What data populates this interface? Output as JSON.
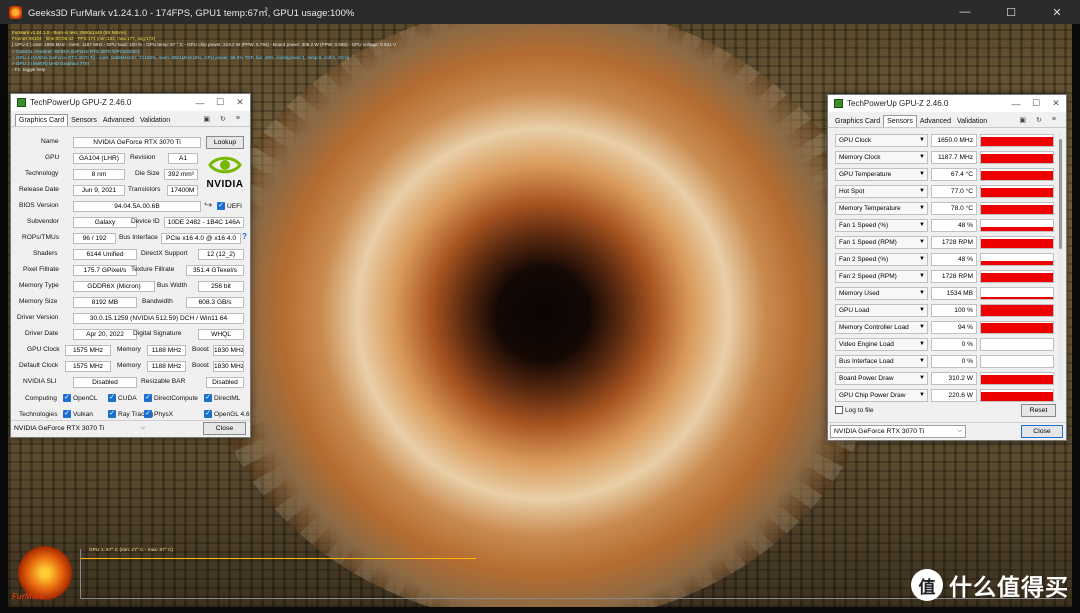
{
  "furmark": {
    "title": "Geeks3D FurMark v1.24.1.0 - 174FPS, GPU1 temp:67㎡, GPU1 usage:100%",
    "overlay": [
      {
        "text": "FurMark v1.24.1.0 - Burn-in test, 2560x1440 (8X MSAA)",
        "color": "yel"
      },
      {
        "text": "Frames:65104 - time:00:06:42 - FPS:174 (min:133, max:177, avg:172)",
        "color": "yel"
      },
      {
        "text": "[ GPU-Z ] core: 1665 MHz - mem: 1187 MHz - GPU load: 100 % - GPU temp: 67 ° C - GPU chip power: 219.2 W (PPW: 0.794) - Board power: 308.2 W (PPW: 0.565) - GPU voltage: 0.831 V",
        "color": ""
      },
      {
        "text": "> OpenGL renderer: NVIDIA GeForce RTX 3070 Ti/PCIe/SSE2",
        "color": "cyan"
      },
      {
        "text": "> GPU 1 (NVIDIA GeForce RTX 3070 Ti) - core: 1665MHz/67 °C/100%, mem: 9501MHz/18%, GPU power: 99.0% TDP, fan: 48%, limits(power:1, temp:0, volt:0, OV:0)",
        "color": "cyan"
      },
      {
        "text": "> GPU 2 (Intel(R) UHD Graphics 770)",
        "color": "cyan"
      },
      {
        "text": "- F1: toggle help",
        "color": ""
      }
    ],
    "graph_label": "GPU 1: 67° C (min: 27° C - max: 67° C)",
    "logo_text": "FurMark",
    "watermark_text": "什么值得买",
    "watermark_icon": "值",
    "window_buttons": {
      "minimize": "—",
      "maximize": "☐",
      "close": "✕"
    }
  },
  "gpuz_card": {
    "title": "TechPowerUp GPU-Z 2.46.0",
    "tabs": [
      "Graphics Card",
      "Sensors",
      "Advanced",
      "Validation"
    ],
    "active_tab": 0,
    "lookup_label": "Lookup",
    "vendor_logo_text": "NVIDIA",
    "uefi_label": "UEFI",
    "fields": {
      "name_label": "Name",
      "name": "NVIDIA GeForce RTX 3070 Ti",
      "gpu_label": "GPU",
      "gpu": "GA104 (LHR)",
      "revision_label": "Revision",
      "revision": "A1",
      "technology_label": "Technology",
      "technology": "8 nm",
      "die_size_label": "Die Size",
      "die_size": "392 mm²",
      "release_label": "Release Date",
      "release": "Jun 9, 2021",
      "transistors_label": "Transistors",
      "transistors": "17400M",
      "bios_label": "BIOS Version",
      "bios": "94.04.5A.00.6B",
      "subvendor_label": "Subvendor",
      "subvendor": "Galaxy",
      "device_id_label": "Device ID",
      "device_id": "10DE 2482 - 1B4C 146A",
      "rops_label": "ROPs/TMUs",
      "rops": "96 / 192",
      "bus_interface_label": "Bus Interface",
      "bus_interface": "PCIe x16 4.0 @ x16 4.0",
      "shaders_label": "Shaders",
      "shaders": "6144 Unified",
      "directx_label": "DirectX Support",
      "directx": "12 (12_2)",
      "pixel_fill_label": "Pixel Fillrate",
      "pixel_fill": "175.7 GPixel/s",
      "texture_fill_label": "Texture Fillrate",
      "texture_fill": "351.4 GTexel/s",
      "memory_type_label": "Memory Type",
      "memory_type": "GDDR6X (Micron)",
      "bus_width_label": "Bus Width",
      "bus_width": "256 bit",
      "memory_size_label": "Memory Size",
      "memory_size": "8192 MB",
      "bandwidth_label": "Bandwidth",
      "bandwidth": "608.3 GB/s",
      "driver_version_label": "Driver Version",
      "driver_version": "30.0.15.1259 (NVIDIA 512.59) DCH / Win11 64",
      "driver_date_label": "Driver Date",
      "driver_date": "Apr 20, 2022",
      "digital_sig_label": "Digital Signature",
      "digital_sig": "WHQL",
      "gpu_clock_label": "GPU Clock",
      "gpu_clock": "1575 MHz",
      "memory_label": "Memory",
      "memory_clock": "1188 MHz",
      "boost_label": "Boost",
      "boost_clock": "1830 MHz",
      "default_clock_label": "Default Clock",
      "default_clock": "1575 MHz",
      "default_memory": "1188 MHz",
      "default_boost": "1830 MHz",
      "sli_label": "NVIDIA SLI",
      "sli": "Disabled",
      "rebar_label": "Resizable BAR",
      "rebar": "Disabled",
      "computing_label": "Computing",
      "technologies_label": "Technologies"
    },
    "computing": [
      "OpenCL",
      "CUDA",
      "DirectCompute",
      "DirectML"
    ],
    "technologies": [
      "Vulkan",
      "Ray Tracing",
      "PhysX",
      "OpenGL 4.6"
    ],
    "selected_gpu": "NVIDIA GeForce RTX 3070 Ti",
    "close_label": "Close",
    "help_glyph": "?",
    "window_buttons": {
      "minimize": "—",
      "maximize": "☐",
      "close": "✕"
    }
  },
  "gpuz_sensors": {
    "title": "TechPowerUp GPU-Z 2.46.0",
    "tabs": [
      "Graphics Card",
      "Sensors",
      "Advanced",
      "Validation"
    ],
    "active_tab": 1,
    "sensors": [
      {
        "name": "GPU Clock",
        "value": "1650.0 MHz",
        "level": 0.85
      },
      {
        "name": "Memory Clock",
        "value": "1187.7 MHz",
        "level": 0.85
      },
      {
        "name": "GPU Temperature",
        "value": "67.4 °C",
        "level": 0.85
      },
      {
        "name": "Hot Spot",
        "value": "77.0 °C",
        "level": 0.85
      },
      {
        "name": "Memory Temperature",
        "value": "78.0 °C",
        "level": 0.85
      },
      {
        "name": "Fan 1 Speed (%)",
        "value": "48 %",
        "level": 0.35
      },
      {
        "name": "Fan 1 Speed (RPM)",
        "value": "1728 RPM",
        "level": 0.85
      },
      {
        "name": "Fan 2 Speed (%)",
        "value": "48 %",
        "level": 0.35
      },
      {
        "name": "Fan 2 Speed (RPM)",
        "value": "1728 RPM",
        "level": 0.85
      },
      {
        "name": "Memory Used",
        "value": "1534 MB",
        "level": 0.15
      },
      {
        "name": "GPU Load",
        "value": "100 %",
        "level": 1.0
      },
      {
        "name": "Memory Controller Load",
        "value": "94 %",
        "level": 0.9
      },
      {
        "name": "Video Engine Load",
        "value": "0 %",
        "level": 0
      },
      {
        "name": "Bus Interface Load",
        "value": "0 %",
        "level": 0
      },
      {
        "name": "Board Power Draw",
        "value": "310.2 W",
        "level": 0.85
      },
      {
        "name": "GPU Chip Power Draw",
        "value": "220.6 W",
        "level": 0.85
      }
    ],
    "log_label": "Log to file",
    "reset_label": "Reset",
    "selected_gpu": "NVIDIA GeForce RTX 3070 Ti",
    "close_label": "Close",
    "window_buttons": {
      "minimize": "—",
      "maximize": "☐",
      "close": "✕"
    }
  },
  "colors": {
    "sensor_bar": "#ee0000",
    "check_blue": "#1c6fd2",
    "nvidia_green": "#76b900"
  }
}
